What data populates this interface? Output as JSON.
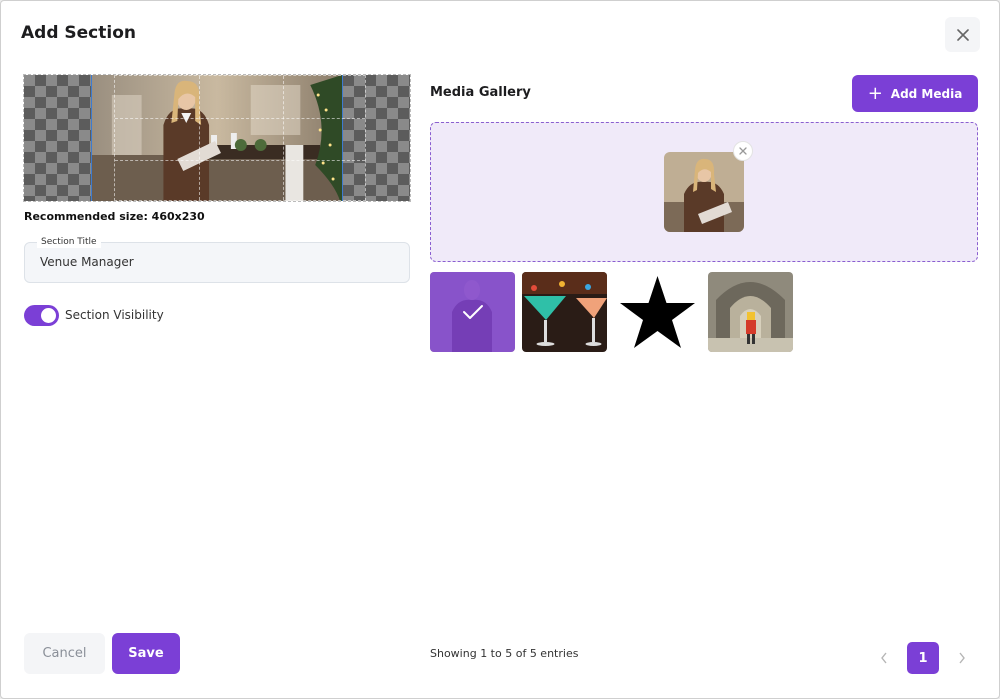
{
  "modal": {
    "title": "Add Section",
    "close_icon": "close-icon"
  },
  "cropper": {
    "image_desc_icon": "photo-woman-holding-laptop",
    "recommended_size": "Recommended size: 460x230"
  },
  "section_title": {
    "label": "Section Title",
    "value": "Venue Manager"
  },
  "visibility": {
    "label": "Section Visibility",
    "enabled": true
  },
  "gallery": {
    "title": "Media Gallery",
    "add_media_label": "Add Media",
    "thumbnails": [
      {
        "name": "woman-with-laptop",
        "selected": true
      },
      {
        "name": "cocktail-glasses",
        "selected": false
      },
      {
        "name": "black-star",
        "selected": false
      },
      {
        "name": "stone-archway-corridor",
        "selected": false
      }
    ]
  },
  "footer": {
    "cancel_label": "Cancel",
    "save_label": "Save",
    "entries_text": "Showing 1 to 5 of 5 entries",
    "current_page": "1"
  },
  "colors": {
    "accent": "#7b3fd6",
    "dropzone_bg": "#f0eaf9"
  }
}
